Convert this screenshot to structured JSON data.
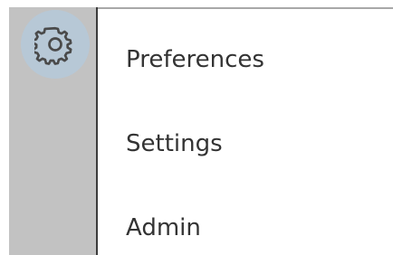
{
  "sidebar": {
    "toggle_icon": "gear-icon"
  },
  "menu": {
    "items": [
      {
        "label": "Preferences"
      },
      {
        "label": "Settings"
      },
      {
        "label": "Admin"
      }
    ]
  }
}
